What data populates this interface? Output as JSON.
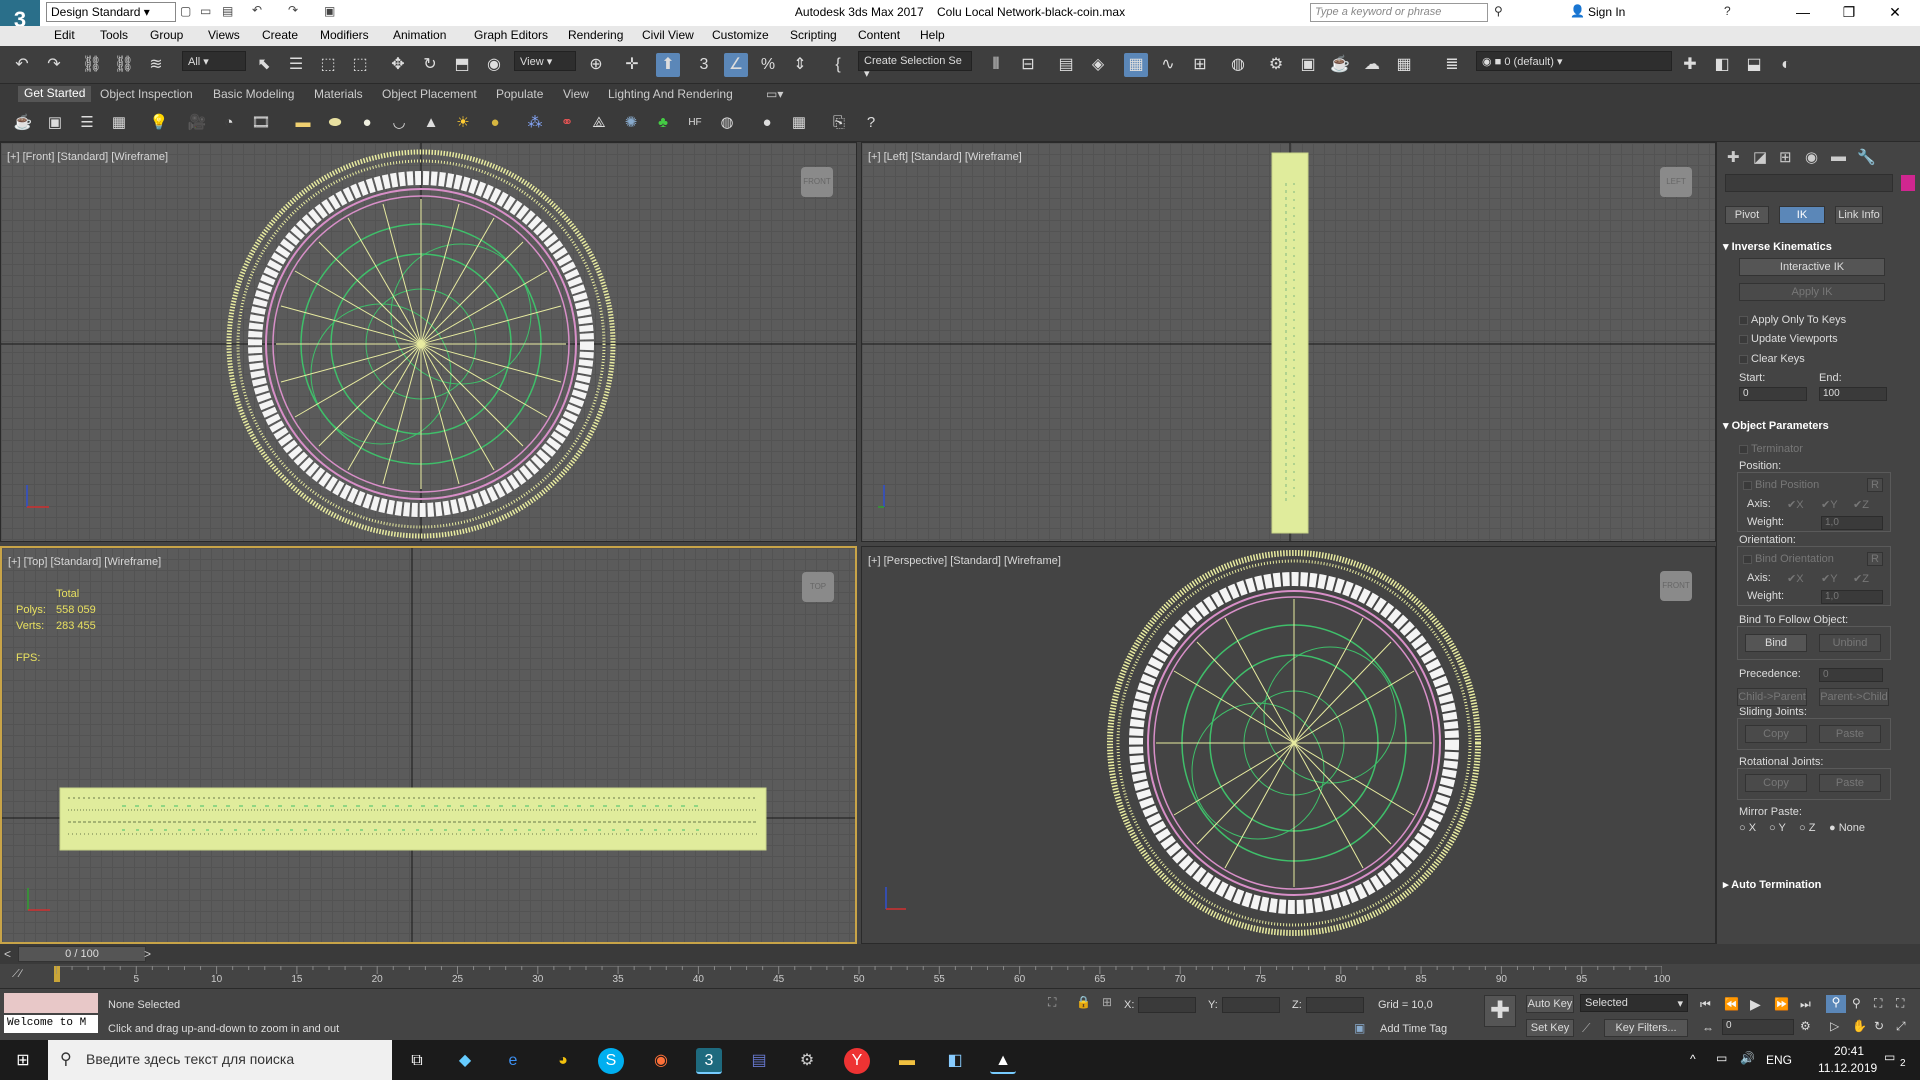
{
  "title": {
    "app_name": "Autodesk 3ds Max 2017",
    "file_name": "Colu Local Network-black-coin.max",
    "workspace": "Design Standard",
    "search_placeholder": "Type a keyword or phrase",
    "sign_in": "Sign In"
  },
  "menu": [
    "Edit",
    "Tools",
    "Group",
    "Views",
    "Create",
    "Modifiers",
    "Animation",
    "Graph Editors",
    "Rendering",
    "Civil View",
    "Customize",
    "Scripting",
    "Content",
    "Help"
  ],
  "toolbar": {
    "selection_filter": "All",
    "ref_coord": "View",
    "named_selection": "Create Selection Se",
    "layer": "0 (default)"
  },
  "ribbon_tabs": [
    "Get Started",
    "Object Inspection",
    "Basic Modeling",
    "Materials",
    "Object Placement",
    "Populate",
    "View",
    "Lighting And Rendering"
  ],
  "viewports": {
    "front": {
      "label": "[+] [Front] [Standard] [Wireframe]",
      "cube": "FRONT"
    },
    "left": {
      "label": "[+] [Left] [Standard] [Wireframe]",
      "cube": "LEFT"
    },
    "top": {
      "label": "[+] [Top] [Standard] [Wireframe]",
      "cube": "TOP"
    },
    "persp": {
      "label": "[+] [Perspective] [Standard] [Wireframe]",
      "cube": "FRONT"
    }
  },
  "stats": {
    "total_label": "Total",
    "polys_label": "Polys:",
    "polys": "558 059",
    "verts_label": "Verts:",
    "verts": "283 455",
    "fps_label": "FPS:"
  },
  "command_panel": {
    "tabs": [
      "Pivot",
      "IK",
      "Link Info"
    ],
    "ik": {
      "header": "Inverse Kinematics",
      "interactive_ik": "Interactive IK",
      "apply_ik": "Apply IK",
      "apply_only_keys": "Apply Only To Keys",
      "update_viewports": "Update Viewports",
      "clear_keys": "Clear Keys",
      "start_label": "Start:",
      "end_label": "End:",
      "start": "0",
      "end": "100"
    },
    "obj": {
      "header": "Object Parameters",
      "terminator": "Terminator",
      "position": "Position:",
      "bind_position": "Bind Position",
      "axis": "Axis:",
      "weight": "Weight:",
      "weight_val": "1,0",
      "orientation": "Orientation:",
      "bind_orientation": "Bind Orientation",
      "bind_to_follow": "Bind To Follow Object:",
      "bind": "Bind",
      "unbind": "Unbind",
      "precedence": "Precedence:",
      "precedence_val": "0",
      "child_parent": "Child->Parent",
      "parent_child": "Parent->Child",
      "sliding": "Sliding Joints:",
      "rotational": "Rotational Joints:",
      "copy": "Copy",
      "paste": "Paste",
      "mirror": "Mirror Paste:",
      "mirror_opts": [
        "X",
        "Y",
        "Z",
        "None"
      ],
      "x": "X",
      "y": "Y",
      "z": "Z",
      "r": "R"
    },
    "auto_term": "Auto Termination"
  },
  "timeline": {
    "frame": "0 / 100",
    "ticks": [
      "5",
      "10",
      "15",
      "20",
      "25",
      "30",
      "35",
      "40",
      "45",
      "50",
      "55",
      "60",
      "65",
      "70",
      "75",
      "80",
      "85",
      "90",
      "95",
      "100"
    ]
  },
  "status": {
    "maxscript": "Welcome to M",
    "selection": "None Selected",
    "prompt": "Click and drag up-and-down to zoom in and out",
    "x_label": "X:",
    "y_label": "Y:",
    "z_label": "Z:",
    "grid": "Grid = 10,0",
    "add_time_tag": "Add Time Tag",
    "auto_key": "Auto Key",
    "set_key": "Set Key",
    "key_filter": "Selected",
    "key_filters_btn": "Key Filters...",
    "frame_field": "0"
  },
  "taskbar": {
    "search_placeholder": "Введите здесь текст для поиска",
    "lang": "ENG",
    "time": "20:41",
    "date": "11.12.2019",
    "notif_count": "2"
  },
  "colors": {
    "accent": "#5b87b8",
    "wire_yellow": "#e8eba0",
    "wire_green": "#3fbf6a",
    "wire_pink": "#d88fc8",
    "active_border": "#c8a448"
  }
}
